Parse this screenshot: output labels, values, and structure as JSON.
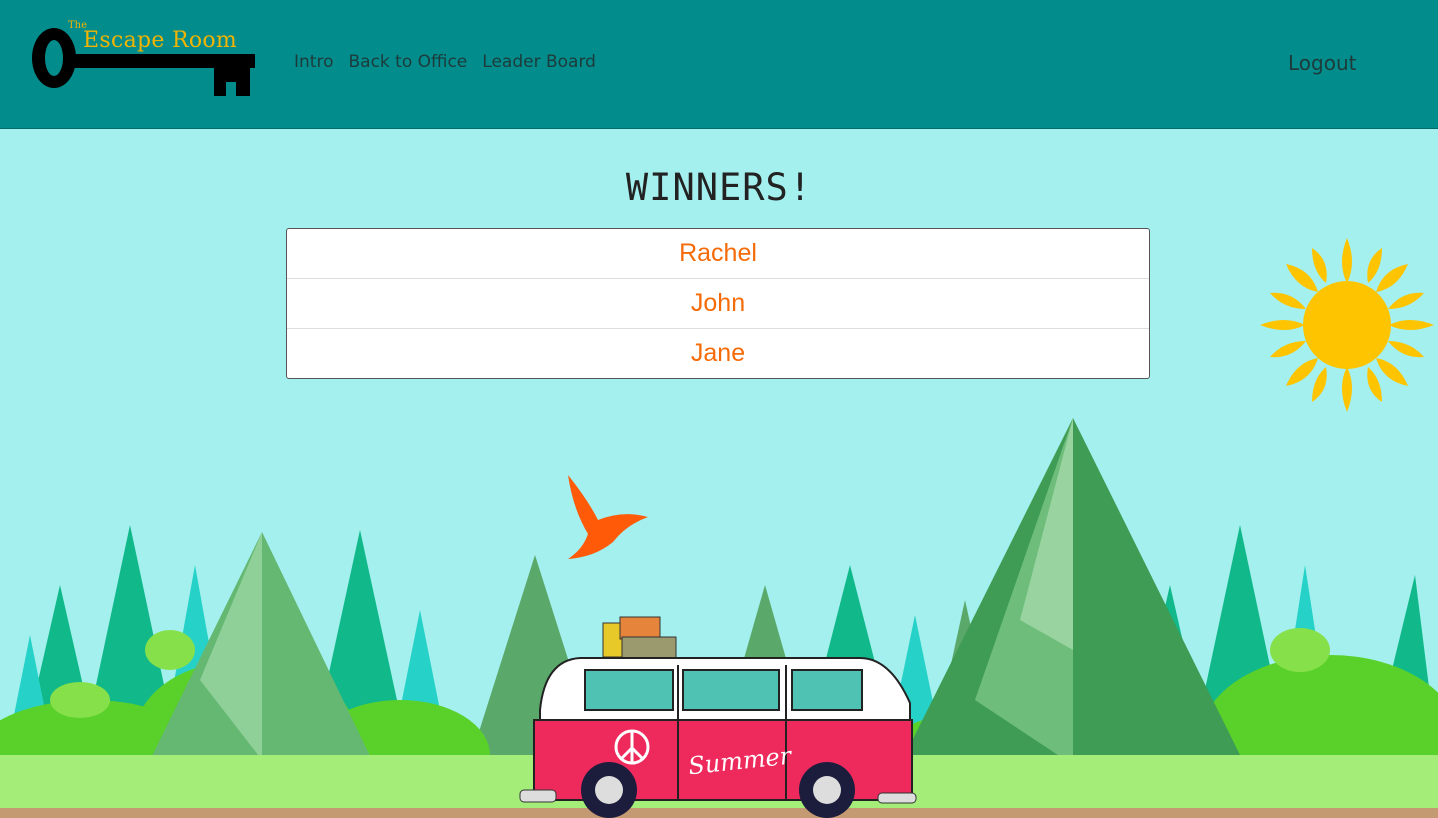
{
  "nav": {
    "logo_the": "The",
    "logo_title": "Escape Room",
    "links": [
      "Intro",
      "Back to Office",
      "Leader Board"
    ],
    "logout": "Logout"
  },
  "main": {
    "heading": "WINNERS!",
    "winners": [
      "Rachel",
      "John",
      "Jane"
    ]
  },
  "illustration": {
    "van_label": "Summer"
  },
  "colors": {
    "navbar": "#028c8c",
    "sky": "#a3f0ee",
    "winner_text": "#f56b08",
    "logo_gold": "#f2b400"
  }
}
